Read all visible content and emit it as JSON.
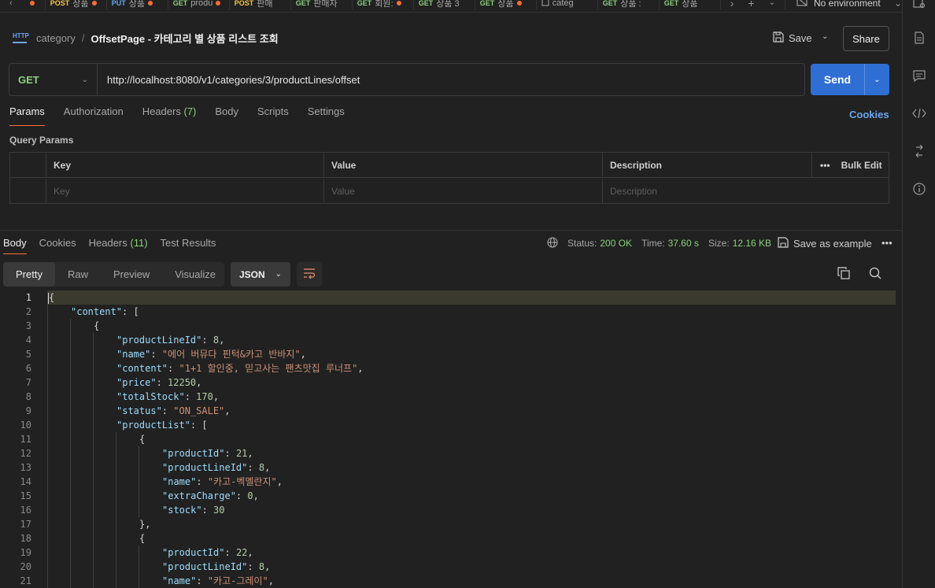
{
  "tabs": [
    {
      "method": "",
      "label": "",
      "dirty": true
    },
    {
      "method": "POST",
      "label": "상품",
      "dirty": true
    },
    {
      "method": "PUT",
      "label": "상품",
      "dirty": true
    },
    {
      "method": "GET",
      "label": "produ",
      "dirty": true
    },
    {
      "method": "POST",
      "label": "판매",
      "dirty": false
    },
    {
      "method": "GET",
      "label": "판매자",
      "dirty": false
    },
    {
      "method": "GET",
      "label": "회원:",
      "dirty": true
    },
    {
      "method": "GET",
      "label": "상품 3",
      "dirty": false
    },
    {
      "method": "GET",
      "label": "상품",
      "dirty": true
    },
    {
      "method": "",
      "label": "categ",
      "dirty": false
    },
    {
      "method": "GET",
      "label": "상품 :",
      "dirty": false
    },
    {
      "method": "GET",
      "label": "상품",
      "dirty": false
    }
  ],
  "environment": {
    "label": "No environment"
  },
  "header": {
    "breadcrumb_parent": "category",
    "breadcrumb_sep": "/",
    "title": "OffsetPage - 카테고리 별 상품 리스트 조회",
    "save_label": "Save",
    "share_label": "Share",
    "http_icon_text": "HTTP"
  },
  "request": {
    "method": "GET",
    "url": "http://localhost:8080/v1/categories/3/productLines/offset",
    "send_label": "Send"
  },
  "request_tabs": [
    {
      "label": "Params",
      "count": "",
      "active": true
    },
    {
      "label": "Authorization",
      "count": "",
      "active": false
    },
    {
      "label": "Headers",
      "count": "(7)",
      "active": false
    },
    {
      "label": "Body",
      "count": "",
      "active": false
    },
    {
      "label": "Scripts",
      "count": "",
      "active": false
    },
    {
      "label": "Settings",
      "count": "",
      "active": false
    }
  ],
  "cookies_link": "Cookies",
  "query_params": {
    "label": "Query Params",
    "columns": [
      "Key",
      "Value",
      "Description"
    ],
    "bulk_edit": "Bulk Edit",
    "placeholders": {
      "key": "Key",
      "value": "Value",
      "description": "Description"
    }
  },
  "response": {
    "tabs": [
      {
        "label": "Body",
        "count": "",
        "active": true
      },
      {
        "label": "Cookies",
        "count": "",
        "active": false
      },
      {
        "label": "Headers",
        "count": "(11)",
        "active": false
      },
      {
        "label": "Test Results",
        "count": "",
        "active": false
      }
    ],
    "status_label": "Status:",
    "status_value": "200 OK",
    "time_label": "Time:",
    "time_value": "37.60 s",
    "size_label": "Size:",
    "size_value": "12.16 KB",
    "save_example": "Save as example",
    "view_modes": [
      "Pretty",
      "Raw",
      "Preview",
      "Visualize"
    ],
    "active_view": "Pretty",
    "format": "JSON"
  },
  "code_lines": [
    {
      "n": "1",
      "indent": 0,
      "tokens": [
        [
          "p",
          "{"
        ]
      ]
    },
    {
      "n": "2",
      "indent": 1,
      "tokens": [
        [
          "k",
          "\"content\""
        ],
        [
          "p",
          ": ["
        ]
      ]
    },
    {
      "n": "3",
      "indent": 2,
      "tokens": [
        [
          "p",
          "{"
        ]
      ]
    },
    {
      "n": "4",
      "indent": 3,
      "tokens": [
        [
          "k",
          "\"productLineId\""
        ],
        [
          "p",
          ": "
        ],
        [
          "n",
          "8"
        ],
        [
          "p",
          ","
        ]
      ]
    },
    {
      "n": "5",
      "indent": 3,
      "tokens": [
        [
          "k",
          "\"name\""
        ],
        [
          "p",
          ": "
        ],
        [
          "s",
          "\"에어 버뮤다 핀턱&카고 반바지\""
        ],
        [
          "p",
          ","
        ]
      ]
    },
    {
      "n": "6",
      "indent": 3,
      "tokens": [
        [
          "k",
          "\"content\""
        ],
        [
          "p",
          ": "
        ],
        [
          "s",
          "\"1+1 할인중, 믿고사는 팬츠맛집 루너프\""
        ],
        [
          "p",
          ","
        ]
      ]
    },
    {
      "n": "7",
      "indent": 3,
      "tokens": [
        [
          "k",
          "\"price\""
        ],
        [
          "p",
          ": "
        ],
        [
          "n",
          "12250"
        ],
        [
          "p",
          ","
        ]
      ]
    },
    {
      "n": "8",
      "indent": 3,
      "tokens": [
        [
          "k",
          "\"totalStock\""
        ],
        [
          "p",
          ": "
        ],
        [
          "n",
          "170"
        ],
        [
          "p",
          ","
        ]
      ]
    },
    {
      "n": "9",
      "indent": 3,
      "tokens": [
        [
          "k",
          "\"status\""
        ],
        [
          "p",
          ": "
        ],
        [
          "s",
          "\"ON_SALE\""
        ],
        [
          "p",
          ","
        ]
      ]
    },
    {
      "n": "10",
      "indent": 3,
      "tokens": [
        [
          "k",
          "\"productList\""
        ],
        [
          "p",
          ": ["
        ]
      ]
    },
    {
      "n": "11",
      "indent": 4,
      "tokens": [
        [
          "p",
          "{"
        ]
      ]
    },
    {
      "n": "12",
      "indent": 5,
      "tokens": [
        [
          "k",
          "\"productId\""
        ],
        [
          "p",
          ": "
        ],
        [
          "n",
          "21"
        ],
        [
          "p",
          ","
        ]
      ]
    },
    {
      "n": "13",
      "indent": 5,
      "tokens": [
        [
          "k",
          "\"productLineId\""
        ],
        [
          "p",
          ": "
        ],
        [
          "n",
          "8"
        ],
        [
          "p",
          ","
        ]
      ]
    },
    {
      "n": "14",
      "indent": 5,
      "tokens": [
        [
          "k",
          "\"name\""
        ],
        [
          "p",
          ": "
        ],
        [
          "s",
          "\"카고-벡멜란지\""
        ],
        [
          "p",
          ","
        ]
      ]
    },
    {
      "n": "15",
      "indent": 5,
      "tokens": [
        [
          "k",
          "\"extraCharge\""
        ],
        [
          "p",
          ": "
        ],
        [
          "n",
          "0"
        ],
        [
          "p",
          ","
        ]
      ]
    },
    {
      "n": "16",
      "indent": 5,
      "tokens": [
        [
          "k",
          "\"stock\""
        ],
        [
          "p",
          ": "
        ],
        [
          "n",
          "30"
        ]
      ]
    },
    {
      "n": "17",
      "indent": 4,
      "tokens": [
        [
          "p",
          "},"
        ]
      ]
    },
    {
      "n": "18",
      "indent": 4,
      "tokens": [
        [
          "p",
          "{"
        ]
      ]
    },
    {
      "n": "19",
      "indent": 5,
      "tokens": [
        [
          "k",
          "\"productId\""
        ],
        [
          "p",
          ": "
        ],
        [
          "n",
          "22"
        ],
        [
          "p",
          ","
        ]
      ]
    },
    {
      "n": "20",
      "indent": 5,
      "tokens": [
        [
          "k",
          "\"productLineId\""
        ],
        [
          "p",
          ": "
        ],
        [
          "n",
          "8"
        ],
        [
          "p",
          ","
        ]
      ]
    },
    {
      "n": "21",
      "indent": 5,
      "tokens": [
        [
          "k",
          "\"name\""
        ],
        [
          "p",
          ": "
        ],
        [
          "s",
          "\"카고-그레이\""
        ],
        [
          "p",
          ","
        ]
      ]
    }
  ],
  "colors": {
    "accent": "#ff6c37",
    "send": "#2f6ed3",
    "get": "#8ad07d",
    "post": "#f5c542",
    "put": "#6aa6ef",
    "link": "#6aa6ef"
  }
}
